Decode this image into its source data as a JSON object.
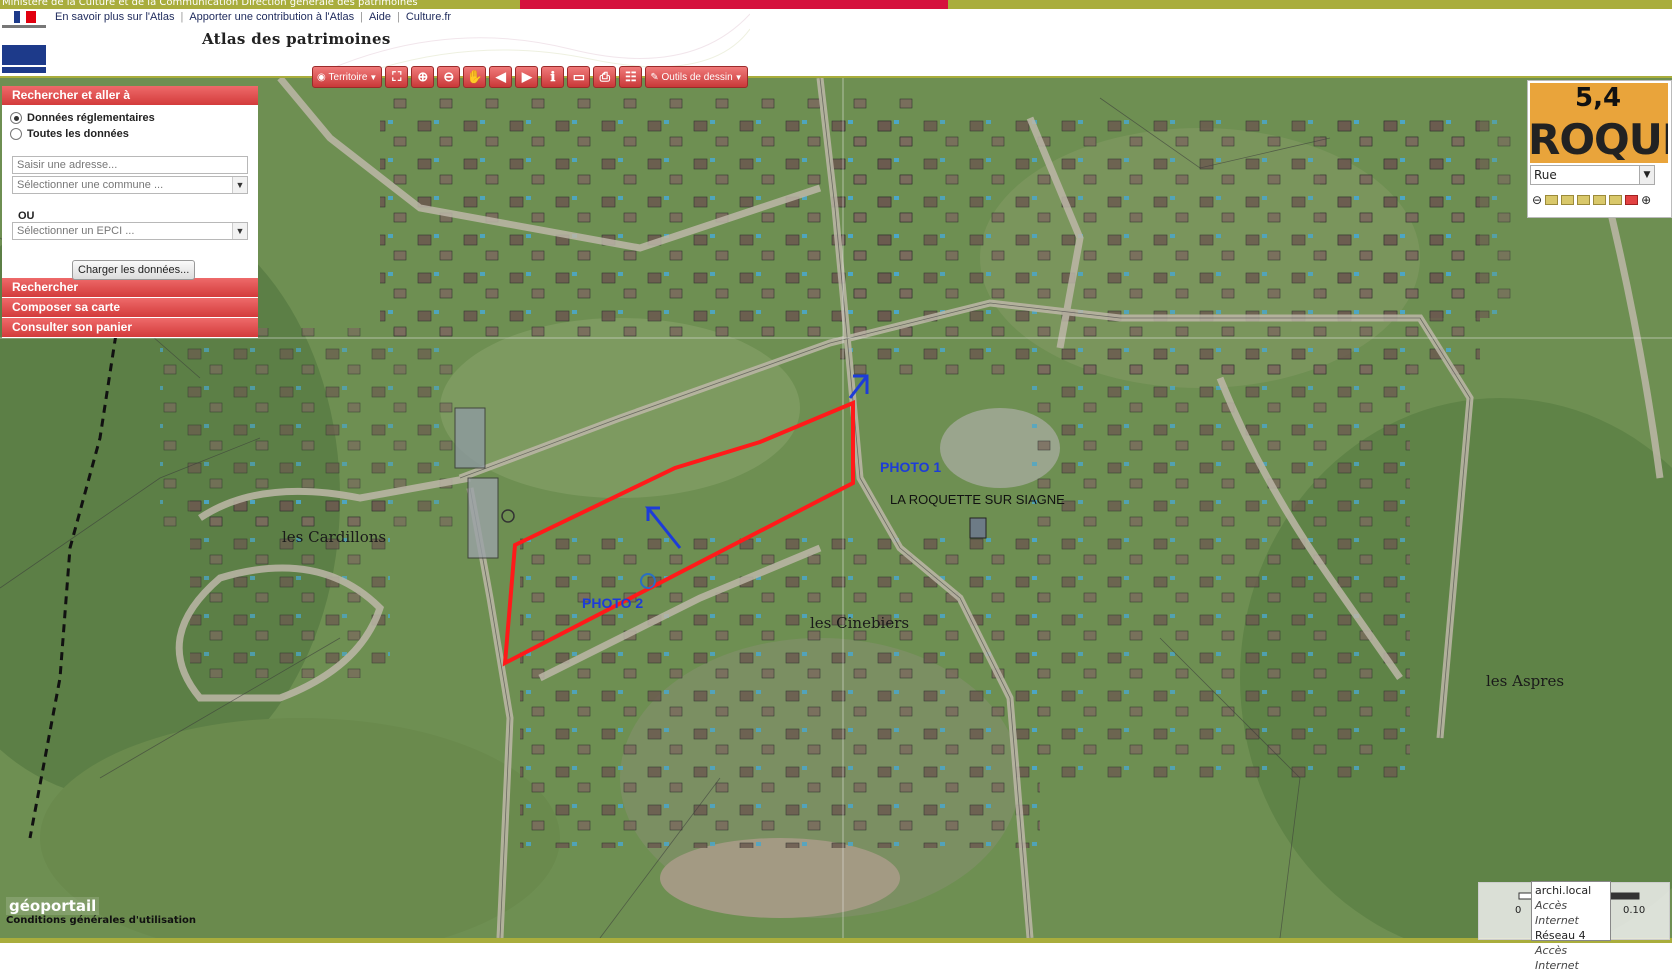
{
  "top_strip": {
    "text": "Ministère de la Culture et de la Communication Direction générale des patrimoines"
  },
  "header": {
    "site_title": "Atlas des patrimoines",
    "links": [
      "En savoir plus sur l'Atlas",
      "Apporter une contribution à l'Atlas",
      "Aide",
      "Culture.fr"
    ]
  },
  "toolbar": {
    "territoire_label": "Territoire",
    "drawing_tools_label": "Outils de dessin"
  },
  "panel": {
    "sections": {
      "search_go": "Rechercher et aller à",
      "search": "Rechercher",
      "compose": "Composer sa carte",
      "cart": "Consulter son panier"
    },
    "radio_regulatory": "Données réglementaires",
    "radio_all": "Toutes les données",
    "address_placeholder": "Saisir une adresse...",
    "commune_select": "Sélectionner une commune ...",
    "or_label": "OU",
    "epci_select": "Sélectionner un EPCI ...",
    "load_button": "Charger les données..."
  },
  "overview": {
    "map_text_number": "5,4",
    "map_text_name": "ROQUET",
    "layer_select": "Rue",
    "zoom_levels": 7,
    "zoom_active_index": 5
  },
  "map": {
    "annotations": {
      "photo1": "PHOTO 1",
      "photo2": "PHOTO 2",
      "town": "LA ROQUETTE SUR SIAGNE"
    },
    "place_names": [
      "les Cardillons",
      "les Cinebiers",
      "les Aspres"
    ],
    "colors": {
      "perimeter": "#ff1a1a",
      "arrows": "#1d3cd8"
    }
  },
  "footer": {
    "geoportail_logo": "géoportail",
    "terms_link": "Conditions générales d'utilisation",
    "scale_zero": "0",
    "scale_value": "0.10"
  },
  "network_popup": {
    "line1": "archi.local",
    "line2": "Accès Internet",
    "line3": "Réseau 4",
    "line4": "Accès Internet"
  }
}
